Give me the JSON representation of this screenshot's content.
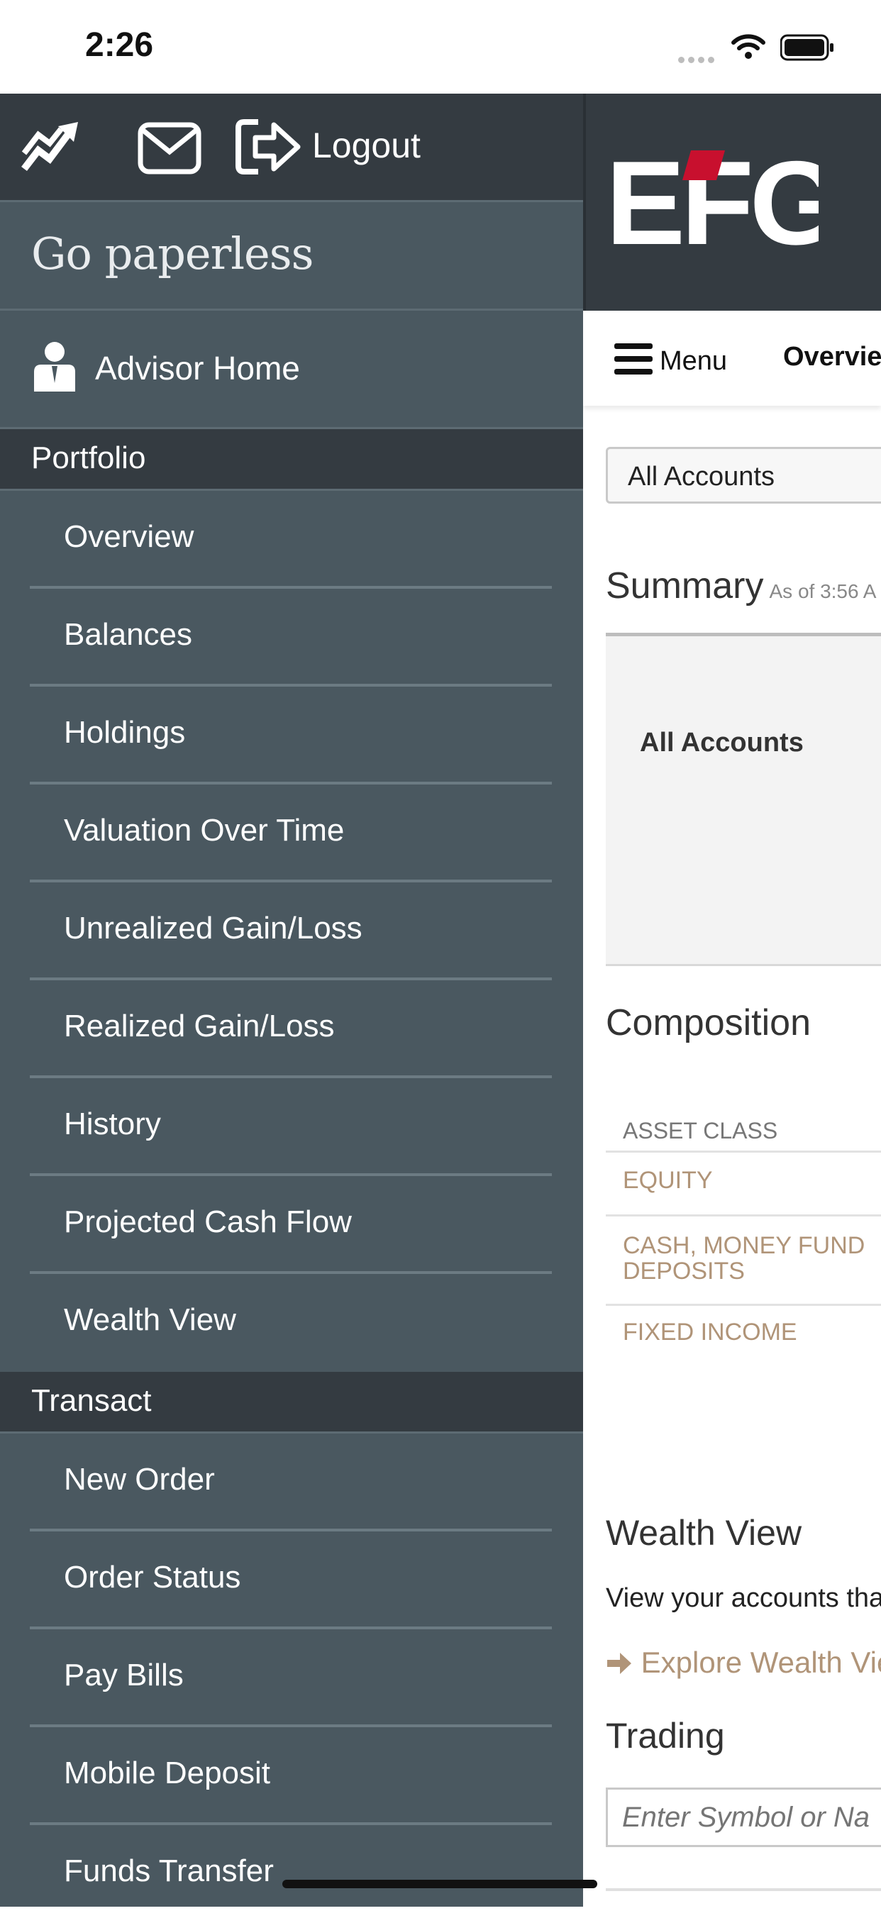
{
  "status_bar": {
    "time": "2:26"
  },
  "sidebar": {
    "top_bar": {
      "logout_label": "Logout"
    },
    "paperless_label": "Go paperless",
    "advisor_home_label": "Advisor Home",
    "sections": [
      {
        "title": "Portfolio",
        "items": [
          "Overview",
          "Balances",
          "Holdings",
          "Valuation Over Time",
          "Unrealized Gain/Loss",
          "Realized Gain/Loss",
          "History",
          "Projected Cash Flow",
          "Wealth View"
        ]
      },
      {
        "title": "Transact",
        "items": [
          "New Order",
          "Order Status",
          "Pay Bills",
          "Mobile Deposit",
          "Funds Transfer"
        ]
      }
    ]
  },
  "main": {
    "logo_text": "EFG",
    "nav": {
      "menu_label": "Menu",
      "active_tab": "Overvie"
    },
    "account_select": "All Accounts",
    "summary": {
      "title": "Summary",
      "as_of": "As of 3:56 A",
      "account_label": "All Accounts"
    },
    "composition": {
      "title": "Composition",
      "header": "ASSET CLASS",
      "rows": [
        "EQUITY",
        "CASH, MONEY FUND DEPOSITS",
        "FIXED INCOME"
      ]
    },
    "wealth_view": {
      "title": "Wealth View",
      "text": "View your accounts tha",
      "link": "Explore Wealth Vie"
    },
    "trading": {
      "title": "Trading",
      "placeholder": "Enter Symbol or Na"
    }
  },
  "colors": {
    "sidebar_bg": "#4a5860",
    "sidebar_dark": "#343b41",
    "accent_link": "#b09478",
    "logo_red": "#c8102e"
  }
}
